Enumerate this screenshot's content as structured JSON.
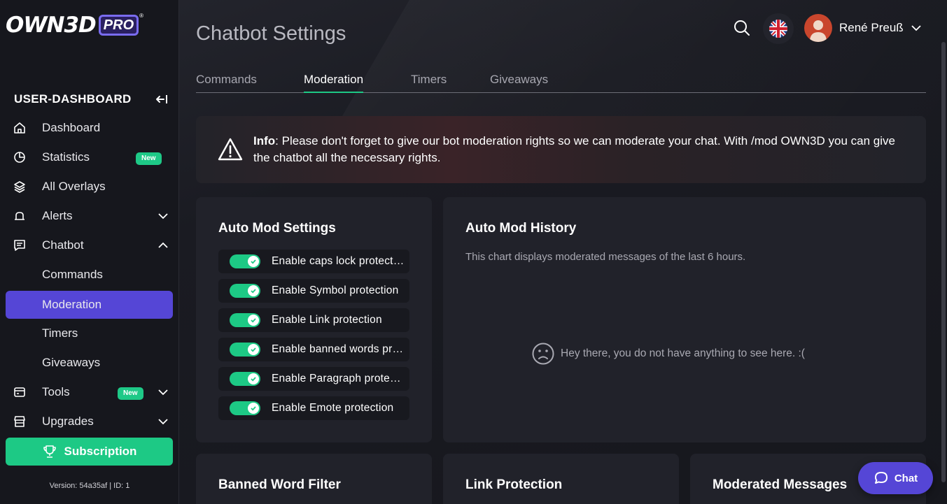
{
  "app": {
    "logo_main": "OWN3D",
    "logo_pro": "PRO",
    "logo_reg": "®"
  },
  "sidebar": {
    "heading": "USER-DASHBOARD",
    "items": [
      {
        "label": "Dashboard",
        "icon": "home-icon"
      },
      {
        "label": "Statistics",
        "icon": "pie-chart-icon",
        "badge": "New"
      },
      {
        "label": "All Overlays",
        "icon": "layers-icon"
      },
      {
        "label": "Alerts",
        "icon": "bell-icon"
      },
      {
        "label": "Chatbot",
        "icon": "chat-icon"
      },
      {
        "label": "Commands"
      },
      {
        "label": "Moderation"
      },
      {
        "label": "Timers"
      },
      {
        "label": "Giveaways"
      },
      {
        "label": "Tools",
        "icon": "tools-icon",
        "badge": "New"
      },
      {
        "label": "Upgrades",
        "icon": "store-icon"
      }
    ],
    "subscription": "Subscription",
    "version": "Version: 54a35af | ID: 1"
  },
  "header": {
    "title": "Chatbot Settings",
    "user_name": "René Preuß"
  },
  "tabs": [
    "Commands",
    "Moderation",
    "Timers",
    "Giveaways"
  ],
  "info": {
    "label": "Info",
    "text": ": Please don't forget to give our bot moderation rights so we can moderate your chat. With /mod OWN3D you can give the chatbot all the necessary rights."
  },
  "auto_mod_settings": {
    "title": "Auto Mod Settings",
    "toggles": [
      {
        "label": "Enable caps lock protection",
        "enabled": true
      },
      {
        "label": "Enable Symbol protection",
        "enabled": true
      },
      {
        "label": "Enable Link protection",
        "enabled": true
      },
      {
        "label": "Enable banned words protection",
        "enabled": true
      },
      {
        "label": "Enable Paragraph protection",
        "enabled": true
      },
      {
        "label": "Enable Emote protection",
        "enabled": true
      }
    ]
  },
  "auto_mod_history": {
    "title": "Auto Mod History",
    "description": "This chart displays moderated messages of the last 6 hours.",
    "empty_text": "Hey there, you do not have anything to see here. :("
  },
  "bottom_cards": {
    "banned_word_filter": "Banned Word Filter",
    "link_protection": "Link Protection",
    "moderated_messages": "Moderated Messages"
  },
  "chat_button": "Chat",
  "colors": {
    "accent": "#5546d6",
    "success": "#1dc985",
    "background": "#16171d"
  }
}
